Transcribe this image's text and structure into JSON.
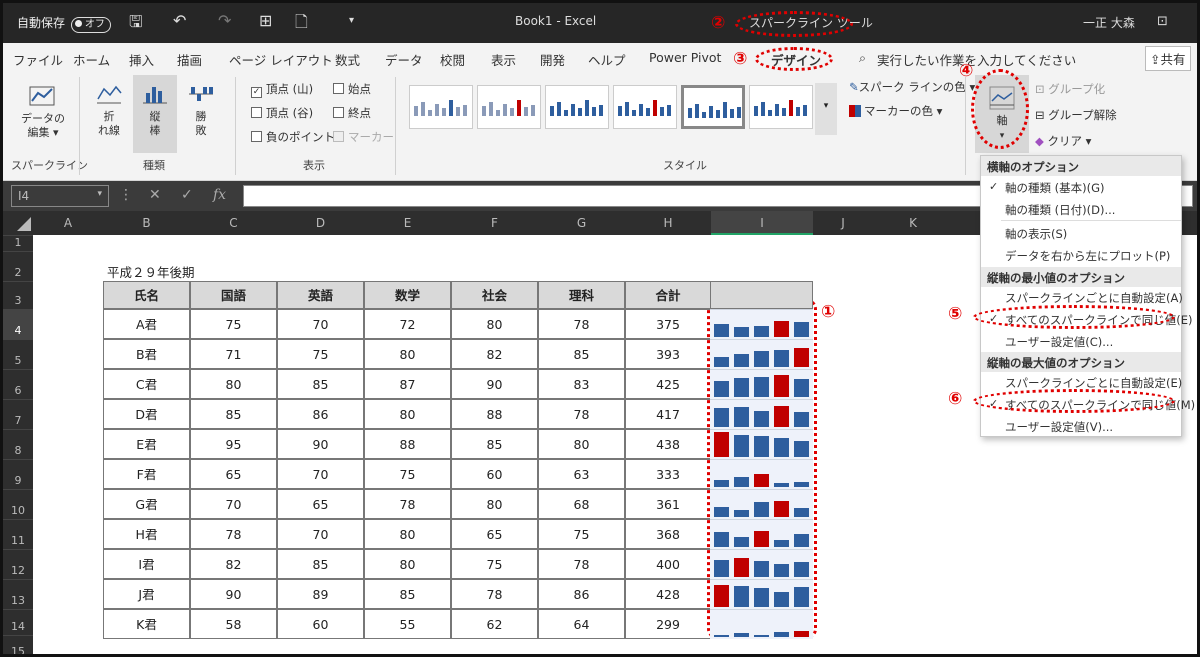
{
  "titlebar": {
    "autosave": "自動保存",
    "autosave_state": "オフ",
    "title": "Book1  -  Excel",
    "context_tool": "スパークライン ツール",
    "user": "一正 大森"
  },
  "menu": {
    "items": [
      "ファイル",
      "ホーム",
      "挿入",
      "描画",
      "ページ レイアウト",
      "数式",
      "データ",
      "校閲",
      "表示",
      "開発",
      "ヘルプ",
      "Power Pivot"
    ],
    "design": "デザイン",
    "tellme": "実行したい作業を入力してください",
    "share": "共有"
  },
  "ribbon": {
    "sparkline_group": "スパークライン",
    "edit_data": "データの",
    "edit_data2": "編集 ▾",
    "type_group": "種類",
    "line": "折",
    "line2": "れ線",
    "column": "縦",
    "column2": "棒",
    "winloss": "勝",
    "winloss2": "敗",
    "show_group": "表示",
    "high_point": "頂点 (山)",
    "low_point": "頂点 (谷)",
    "negative": "負のポイント",
    "first_point": "始点",
    "last_point": "終点",
    "markers": "マーカー",
    "style_group": "スタイル",
    "spark_color": "スパーク ラインの色 ▾",
    "marker_color": "マーカーの色 ▾",
    "axis": "軸",
    "group": "グループ化",
    "ungroup": "グループ解除",
    "clear": "クリア ▾"
  },
  "formula": {
    "namebox": "I4",
    "fx": "fx"
  },
  "columns": [
    "A",
    "B",
    "C",
    "D",
    "E",
    "F",
    "G",
    "H",
    "I",
    "J",
    "K"
  ],
  "rows": [
    "1",
    "2",
    "3",
    "4",
    "5",
    "6",
    "7",
    "8",
    "9",
    "10",
    "11",
    "12",
    "13",
    "14",
    "15"
  ],
  "sheet": {
    "caption": "平成２９年後期",
    "headers": [
      "氏名",
      "国語",
      "英語",
      "数学",
      "社会",
      "理科",
      "合計"
    ],
    "data": [
      [
        "A君",
        "75",
        "70",
        "72",
        "80",
        "78",
        "375"
      ],
      [
        "B君",
        "71",
        "75",
        "80",
        "82",
        "85",
        "393"
      ],
      [
        "C君",
        "80",
        "85",
        "87",
        "90",
        "83",
        "425"
      ],
      [
        "D君",
        "85",
        "86",
        "80",
        "88",
        "78",
        "417"
      ],
      [
        "E君",
        "95",
        "90",
        "88",
        "85",
        "80",
        "438"
      ],
      [
        "F君",
        "65",
        "70",
        "75",
        "60",
        "63",
        "333"
      ],
      [
        "G君",
        "70",
        "65",
        "78",
        "80",
        "68",
        "361"
      ],
      [
        "H君",
        "78",
        "70",
        "80",
        "65",
        "75",
        "368"
      ],
      [
        "I君",
        "82",
        "85",
        "80",
        "75",
        "78",
        "400"
      ],
      [
        "J君",
        "90",
        "89",
        "85",
        "78",
        "86",
        "428"
      ],
      [
        "K君",
        "58",
        "60",
        "55",
        "62",
        "64",
        "299"
      ]
    ]
  },
  "dropdown": {
    "h1": "横軸のオプション",
    "i1": "軸の種類 (基本)(G)",
    "i2": "軸の種類 (日付)(D)...",
    "i3": "軸の表示(S)",
    "i4": "データを右から左にプロット(P)",
    "h2": "縦軸の最小値のオプション",
    "i5": "スパークラインごとに自動設定(A)",
    "i6": "すべてのスパークラインで同じ値(E)",
    "i7": "ユーザー設定値(C)...",
    "h3": "縦軸の最大値のオプション",
    "i8": "スパークラインごとに自動設定(E)",
    "i9": "すべてのスパークラインで同じ値(M)",
    "i10": "ユーザー設定値(V)..."
  },
  "annotations": [
    "①",
    "②",
    "③",
    "④",
    "⑤",
    "⑥"
  ],
  "colors": {
    "bar": "#2e5e9e",
    "high": "#c00000",
    "annotation": "#e00000"
  }
}
